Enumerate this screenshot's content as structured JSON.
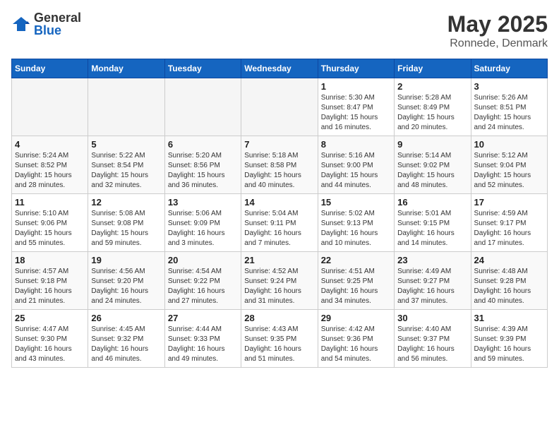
{
  "header": {
    "logo_general": "General",
    "logo_blue": "Blue",
    "title": "May 2025",
    "subtitle": "Ronnede, Denmark"
  },
  "weekdays": [
    "Sunday",
    "Monday",
    "Tuesday",
    "Wednesday",
    "Thursday",
    "Friday",
    "Saturday"
  ],
  "weeks": [
    [
      {
        "day": "",
        "info": ""
      },
      {
        "day": "",
        "info": ""
      },
      {
        "day": "",
        "info": ""
      },
      {
        "day": "",
        "info": ""
      },
      {
        "day": "1",
        "info": "Sunrise: 5:30 AM\nSunset: 8:47 PM\nDaylight: 15 hours\nand 16 minutes."
      },
      {
        "day": "2",
        "info": "Sunrise: 5:28 AM\nSunset: 8:49 PM\nDaylight: 15 hours\nand 20 minutes."
      },
      {
        "day": "3",
        "info": "Sunrise: 5:26 AM\nSunset: 8:51 PM\nDaylight: 15 hours\nand 24 minutes."
      }
    ],
    [
      {
        "day": "4",
        "info": "Sunrise: 5:24 AM\nSunset: 8:52 PM\nDaylight: 15 hours\nand 28 minutes."
      },
      {
        "day": "5",
        "info": "Sunrise: 5:22 AM\nSunset: 8:54 PM\nDaylight: 15 hours\nand 32 minutes."
      },
      {
        "day": "6",
        "info": "Sunrise: 5:20 AM\nSunset: 8:56 PM\nDaylight: 15 hours\nand 36 minutes."
      },
      {
        "day": "7",
        "info": "Sunrise: 5:18 AM\nSunset: 8:58 PM\nDaylight: 15 hours\nand 40 minutes."
      },
      {
        "day": "8",
        "info": "Sunrise: 5:16 AM\nSunset: 9:00 PM\nDaylight: 15 hours\nand 44 minutes."
      },
      {
        "day": "9",
        "info": "Sunrise: 5:14 AM\nSunset: 9:02 PM\nDaylight: 15 hours\nand 48 minutes."
      },
      {
        "day": "10",
        "info": "Sunrise: 5:12 AM\nSunset: 9:04 PM\nDaylight: 15 hours\nand 52 minutes."
      }
    ],
    [
      {
        "day": "11",
        "info": "Sunrise: 5:10 AM\nSunset: 9:06 PM\nDaylight: 15 hours\nand 55 minutes."
      },
      {
        "day": "12",
        "info": "Sunrise: 5:08 AM\nSunset: 9:08 PM\nDaylight: 15 hours\nand 59 minutes."
      },
      {
        "day": "13",
        "info": "Sunrise: 5:06 AM\nSunset: 9:09 PM\nDaylight: 16 hours\nand 3 minutes."
      },
      {
        "day": "14",
        "info": "Sunrise: 5:04 AM\nSunset: 9:11 PM\nDaylight: 16 hours\nand 7 minutes."
      },
      {
        "day": "15",
        "info": "Sunrise: 5:02 AM\nSunset: 9:13 PM\nDaylight: 16 hours\nand 10 minutes."
      },
      {
        "day": "16",
        "info": "Sunrise: 5:01 AM\nSunset: 9:15 PM\nDaylight: 16 hours\nand 14 minutes."
      },
      {
        "day": "17",
        "info": "Sunrise: 4:59 AM\nSunset: 9:17 PM\nDaylight: 16 hours\nand 17 minutes."
      }
    ],
    [
      {
        "day": "18",
        "info": "Sunrise: 4:57 AM\nSunset: 9:18 PM\nDaylight: 16 hours\nand 21 minutes."
      },
      {
        "day": "19",
        "info": "Sunrise: 4:56 AM\nSunset: 9:20 PM\nDaylight: 16 hours\nand 24 minutes."
      },
      {
        "day": "20",
        "info": "Sunrise: 4:54 AM\nSunset: 9:22 PM\nDaylight: 16 hours\nand 27 minutes."
      },
      {
        "day": "21",
        "info": "Sunrise: 4:52 AM\nSunset: 9:24 PM\nDaylight: 16 hours\nand 31 minutes."
      },
      {
        "day": "22",
        "info": "Sunrise: 4:51 AM\nSunset: 9:25 PM\nDaylight: 16 hours\nand 34 minutes."
      },
      {
        "day": "23",
        "info": "Sunrise: 4:49 AM\nSunset: 9:27 PM\nDaylight: 16 hours\nand 37 minutes."
      },
      {
        "day": "24",
        "info": "Sunrise: 4:48 AM\nSunset: 9:28 PM\nDaylight: 16 hours\nand 40 minutes."
      }
    ],
    [
      {
        "day": "25",
        "info": "Sunrise: 4:47 AM\nSunset: 9:30 PM\nDaylight: 16 hours\nand 43 minutes."
      },
      {
        "day": "26",
        "info": "Sunrise: 4:45 AM\nSunset: 9:32 PM\nDaylight: 16 hours\nand 46 minutes."
      },
      {
        "day": "27",
        "info": "Sunrise: 4:44 AM\nSunset: 9:33 PM\nDaylight: 16 hours\nand 49 minutes."
      },
      {
        "day": "28",
        "info": "Sunrise: 4:43 AM\nSunset: 9:35 PM\nDaylight: 16 hours\nand 51 minutes."
      },
      {
        "day": "29",
        "info": "Sunrise: 4:42 AM\nSunset: 9:36 PM\nDaylight: 16 hours\nand 54 minutes."
      },
      {
        "day": "30",
        "info": "Sunrise: 4:40 AM\nSunset: 9:37 PM\nDaylight: 16 hours\nand 56 minutes."
      },
      {
        "day": "31",
        "info": "Sunrise: 4:39 AM\nSunset: 9:39 PM\nDaylight: 16 hours\nand 59 minutes."
      }
    ]
  ]
}
